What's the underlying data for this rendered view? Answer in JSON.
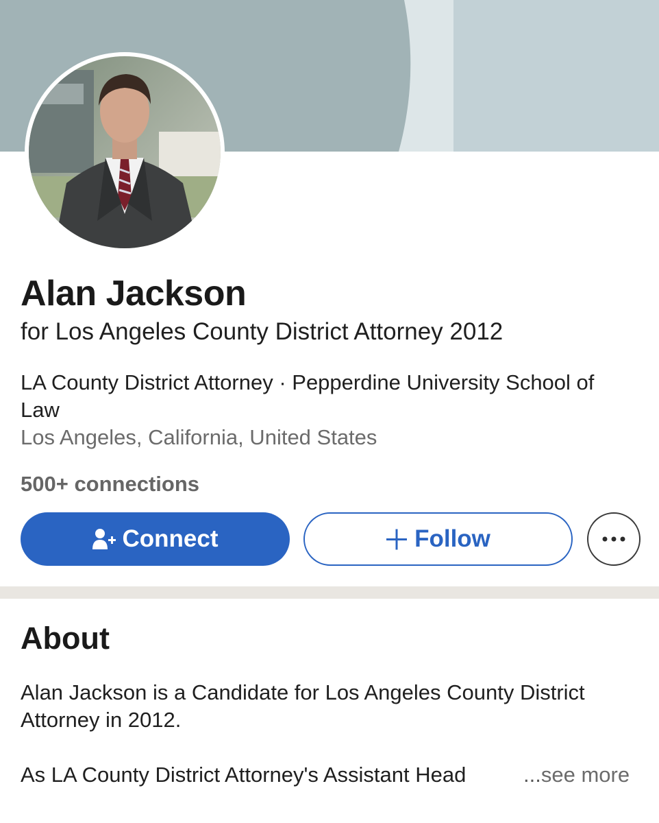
{
  "profile": {
    "name": "Alan Jackson",
    "headline": "for Los Angeles County District Attorney 2012",
    "affiliations": "LA County District Attorney · Pepperdine University School of Law",
    "location": "Los Angeles, California, United States",
    "connections": "500+ connections"
  },
  "actions": {
    "connect_label": "Connect",
    "follow_label": "Follow",
    "more_label": "•••"
  },
  "about": {
    "title": "About",
    "paragraph1": "Alan Jackson is a Candidate for Los Angeles County District Attorney in 2012.",
    "paragraph2": "As LA County District Attorney's Assistant Head",
    "ellipsis": "...",
    "see_more": "see more"
  },
  "colors": {
    "primary_blue": "#2a64c2",
    "cover_dark": "#a1b3b6",
    "cover_light": "#c2d1d6",
    "divider": "#e9e6e1"
  },
  "icons": {
    "connect": "person-add-icon",
    "follow": "plus-icon",
    "more": "more-horizontal-icon"
  }
}
